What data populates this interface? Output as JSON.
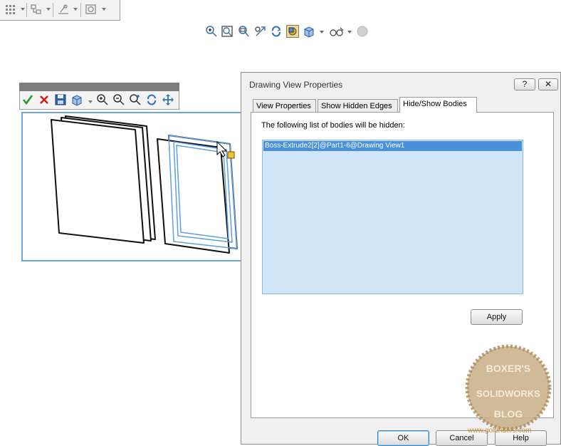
{
  "command_bar": {
    "icons": [
      "grid-icon",
      "view-layout-icon",
      "sketch-icon",
      "annotation-icon"
    ]
  },
  "view_toolbar": {
    "icons": [
      "zoom-to-area-icon",
      "zoom-to-fit-icon",
      "zoom-in-out-icon",
      "section-view-icon",
      "rotate-icon",
      "display-style-icon",
      "view-orientation-icon",
      "hide-show-items-icon",
      "appearance-icon"
    ]
  },
  "drawing_view_toolbar": {
    "icons": [
      "ok-checkmark-icon",
      "cancel-x-icon",
      "save-icon",
      "view-orientation-icon",
      "zoom-in-icon",
      "zoom-out-icon",
      "zoom-to-area-icon",
      "rotate-icon",
      "pan-icon"
    ]
  },
  "dialog": {
    "title": "Drawing View Properties",
    "help_button": "?",
    "close_button": "✕",
    "tabs": [
      {
        "label": "View Properties",
        "selected": false
      },
      {
        "label": "Show Hidden Edges",
        "selected": false
      },
      {
        "label": "Hide/Show Bodies",
        "selected": true
      }
    ],
    "hidden_list_label": "The following list of bodies will be hidden:",
    "hidden_bodies": [
      "Boss-Extrude2[2]@Part1-6@Drawing View1"
    ],
    "apply_label": "Apply",
    "ok_label": "OK",
    "cancel_label": "Cancel",
    "help_label": "Help"
  },
  "watermark": {
    "lines": [
      "BOXER'S",
      "SOLIDWORKS",
      "BLOG"
    ],
    "url": "www.goldriders.com"
  },
  "colors": {
    "selection_blue": "#4a90d9",
    "list_background": "#cfe5f8",
    "view_border": "#6aa6e2",
    "dialog_background": "#f0f0f0"
  }
}
